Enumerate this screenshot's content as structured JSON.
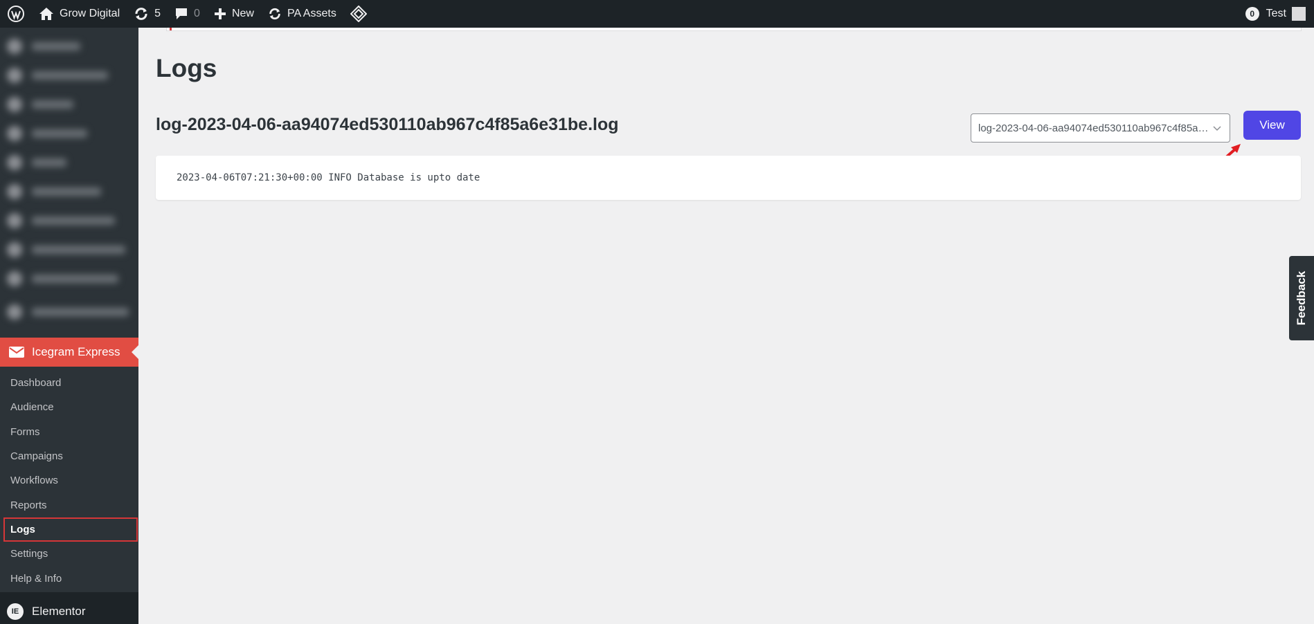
{
  "admin_bar": {
    "site_name": "Grow Digital",
    "updates_count": "5",
    "comments_count": "0",
    "new_label": "New",
    "pa_assets_label": "PA Assets",
    "notifications_count": "0",
    "user_name": "Test"
  },
  "sidebar": {
    "plugin_menu_label": "Icegram Express",
    "submenu": [
      {
        "label": "Dashboard"
      },
      {
        "label": "Audience"
      },
      {
        "label": "Forms"
      },
      {
        "label": "Campaigns"
      },
      {
        "label": "Workflows"
      },
      {
        "label": "Reports"
      },
      {
        "label": "Logs",
        "current": true
      },
      {
        "label": "Settings"
      },
      {
        "label": "Help & Info"
      }
    ],
    "next_menu_label": "Elementor",
    "elementor_icon_text": "IE"
  },
  "main": {
    "page_title": "Logs",
    "file_title": "log-2023-04-06-aa94074ed530110ab967c4f85a6e31be.log",
    "select": {
      "value": "log-2023-04-06-aa94074ed530110ab967c4f85a6e31be.log"
    },
    "view_button": "View",
    "log_line": "2023-04-06T07:21:30+00:00 INFO Database is upto date"
  },
  "feedback_tab": "Feedback",
  "colors": {
    "admin_bar_bg": "#1d2327",
    "sidebar_bg": "#2c3338",
    "plugin_menu_bg": "#e14d43",
    "view_button_bg": "#5046e5",
    "highlight_border": "#d63638",
    "page_bg": "#f0f0f1"
  }
}
